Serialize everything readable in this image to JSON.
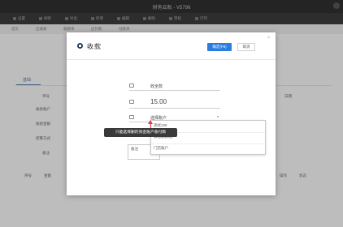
{
  "window": {
    "title": "财务云账 - V5796"
  },
  "toolbar": {
    "items": [
      "设置",
      "刷新",
      "导出",
      "新增",
      "编辑",
      "删除",
      "审核",
      "打印"
    ]
  },
  "background": {
    "subbar_items": [
      "首页",
      "应收款",
      "收款单",
      "应付款",
      "付款单"
    ],
    "tab_label": "基础",
    "labels": [
      "单号",
      "收款账户",
      "收款金额",
      "结算方式",
      "备注",
      "序号",
      "金额",
      "操作",
      "日期",
      "状态"
    ]
  },
  "modal": {
    "title": "收款",
    "ok_label": "确定(F8)",
    "cancel_label": "取消",
    "close_label": "×",
    "payer": "收全款",
    "amount": "15.00",
    "account_placeholder": "选择账户",
    "memo_label": "备注"
  },
  "dropdown": {
    "options": [
      "测试100",
      "微信收款账户",
      "门店账户"
    ]
  },
  "tooltip": {
    "text": "只能选择删的资金账户收付款"
  },
  "colors": {
    "accent": "#2b7de1",
    "amount": "#e03a3a",
    "tooltip_bg": "#3a3a3a"
  }
}
